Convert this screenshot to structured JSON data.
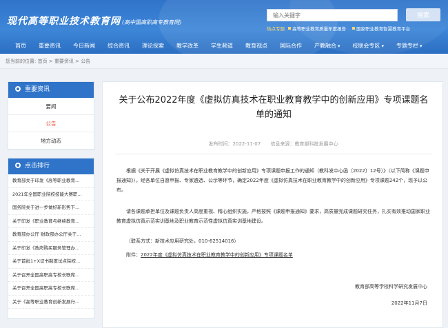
{
  "header": {
    "site_title": "现代高等职业技术教育网",
    "site_subtitle": "(高中国高职高专教育网)",
    "search_placeholder": "输入关键字",
    "search_button": "搜索",
    "hot_label": "热点专题",
    "hot_items": [
      "高等职业教育质量年度报告",
      "国家职业教育智慧教育平台"
    ]
  },
  "nav": {
    "items": [
      "首页",
      "重要资讯",
      "今日新闻",
      "综合资讯",
      "理论探索",
      "教学改革",
      "学生频道",
      "教育视点",
      "国际合作",
      "产教融合",
      "校联会专区",
      "专题专栏"
    ]
  },
  "breadcrumb": {
    "prefix": "您当前的位置:",
    "items": [
      "首页",
      "重要资讯",
      "公告"
    ],
    "separator": ">"
  },
  "sidebar": {
    "news_title": "重要资讯",
    "news_items": [
      "要闻",
      "公告",
      "地方动态"
    ],
    "ranking_title": "点击排行",
    "ranking_items": [
      "教育部关于印发《高等职业教育...",
      "2021年全国职业院校技能大赛职...",
      "国务院关于进一步做好新形势下...",
      "关于印发《职业教育与继续教育...",
      "教育部办公厅 财政部办公厅关于...",
      "关于印发《政府购买服务管理办...",
      "关于首批1+X证书制度试点院校...",
      "关于召开全国高职高专校长联席...",
      "关于召开全国高职高专校长联席...",
      "关于《高等职业教育创新发展行..."
    ]
  },
  "article": {
    "title": "关于公布2022年度《虚拟仿真技术在职业教育教学中的创新应用》专项课题名单的通知",
    "publish_time": "发布时间：2022-11-07",
    "source": "信息来源：教育部科技发展中心",
    "para1": "根据《关于开展《虚拟仿真技术在职业教育教学中的创新应用》专项课题申报工作的通知（教科发中心函〔2022〕12号）》（以下简称《课题申报通知》），经各单位自愿申报、专家遴选、公示等环节，确定2022年度《虚拟仿真技术在职业教育教学中的创新应用》专项课题242个，现予以公布。",
    "para2": "请各课题承担单位及课题负责人高度重视、精心组织实施，严格按照《课题申报通知》要求，高质量完成课题研究任务，扎实有效推动国家职业教育虚拟仿真示范实训基地及职业教育示范性虚拟仿真实训基地建设。",
    "contact": "（联系方式：新技术应用研究处，010-62514016）",
    "attachment_prefix": "附件：",
    "attachment_link": "2022年度《虚拟仿真技术在职业教育教学中的创新应用》专项课题名单",
    "signature": "教育部高等学校科学研究发展中心",
    "date": "2022年11月7日"
  }
}
